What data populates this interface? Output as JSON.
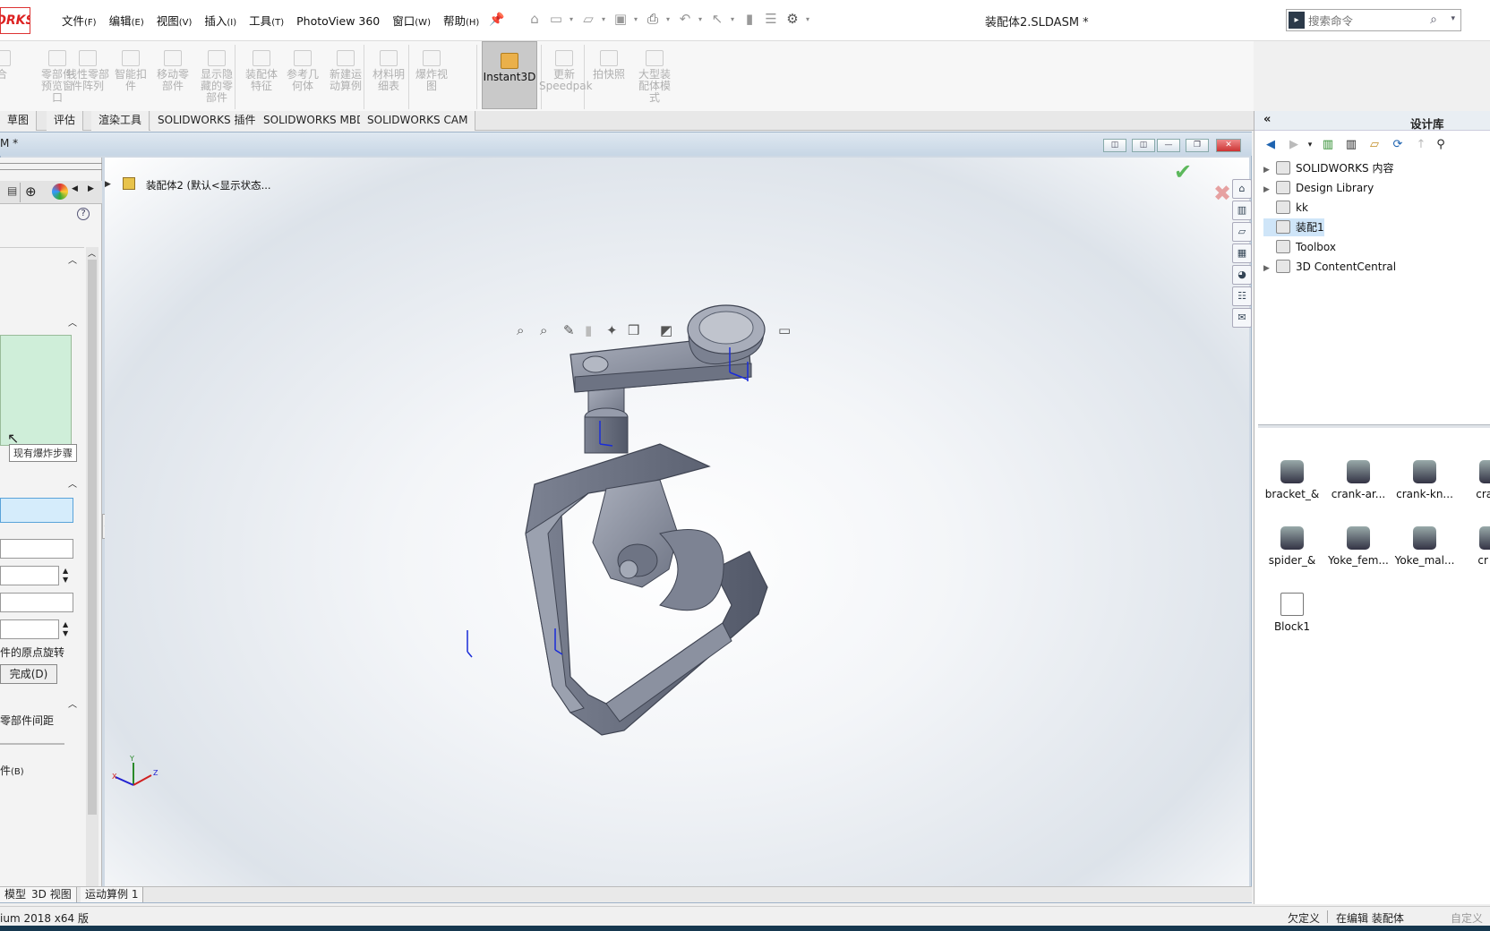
{
  "app": {
    "logo_text": "ORKS",
    "document_title": "装配体2.SLDASM *"
  },
  "menu": [
    {
      "label": "文件",
      "key": "(F)"
    },
    {
      "label": "编辑",
      "key": "(E)"
    },
    {
      "label": "视图",
      "key": "(V)"
    },
    {
      "label": "插入",
      "key": "(I)"
    },
    {
      "label": "工具",
      "key": "(T)"
    },
    {
      "label": "PhotoView 360",
      "key": ""
    },
    {
      "label": "窗口",
      "key": "(W)"
    },
    {
      "label": "帮助",
      "key": "(H)"
    }
  ],
  "search": {
    "placeholder": "搜索命令"
  },
  "ribbon": {
    "items": [
      "合",
      "零部件\n预览窗\n口",
      "线性零部\n件阵列",
      "智能扣\n件",
      "移动零\n部件",
      "显示隐\n藏的零\n部件",
      "装配体\n特征",
      "参考几\n何体",
      "新建运\n动算例",
      "材料明\n细表",
      "爆炸视\n图",
      "Instant3D",
      "更新\nSpeedpak",
      "拍快照",
      "大型装\n配体模\n式"
    ]
  },
  "tabs": [
    "草图",
    "评估",
    "渲染工具",
    "SOLIDWORKS 插件",
    "SOLIDWORKS MBD",
    "SOLIDWORKS CAM"
  ],
  "doc_window": {
    "title": "M *"
  },
  "feature_tree": {
    "root": "装配体2 (默认<显示状态..."
  },
  "left_panel": {
    "tooltip": "现有爆炸步骤",
    "rotate_label": "件的原点旋转",
    "done_button": "完成(D)",
    "spacing_label": "零部件间距",
    "components_label": "件",
    "components_key": "(B)"
  },
  "bottom_tabs": [
    "模型",
    "3D 视图",
    "运动算例 1"
  ],
  "status_bar": {
    "version": "ium 2018 x64 版",
    "underdefined": "欠定义",
    "editing": "在编辑 装配体",
    "custom": "自定义"
  },
  "task_pane": {
    "title": "设计库",
    "tree": [
      {
        "label": "SOLIDWORKS 内容",
        "expandable": true
      },
      {
        "label": "Design Library",
        "expandable": true
      },
      {
        "label": "kk",
        "expandable": false
      },
      {
        "label": "装配1",
        "expandable": false,
        "selected": true
      },
      {
        "label": "Toolbox",
        "expandable": false
      },
      {
        "label": "3D ContentCentral",
        "expandable": true
      }
    ],
    "library": [
      "bracket_&",
      "crank-ar...",
      "crank-kn...",
      "crank",
      "spider_&",
      "Yoke_fem...",
      "Yoke_mal...",
      "cr su",
      "Block1"
    ]
  },
  "colors": {
    "accent": "#1565c0",
    "viewport_bg": "#eef1f5",
    "model_gray": "#8d93a3",
    "selection": "#cfe5f8"
  }
}
